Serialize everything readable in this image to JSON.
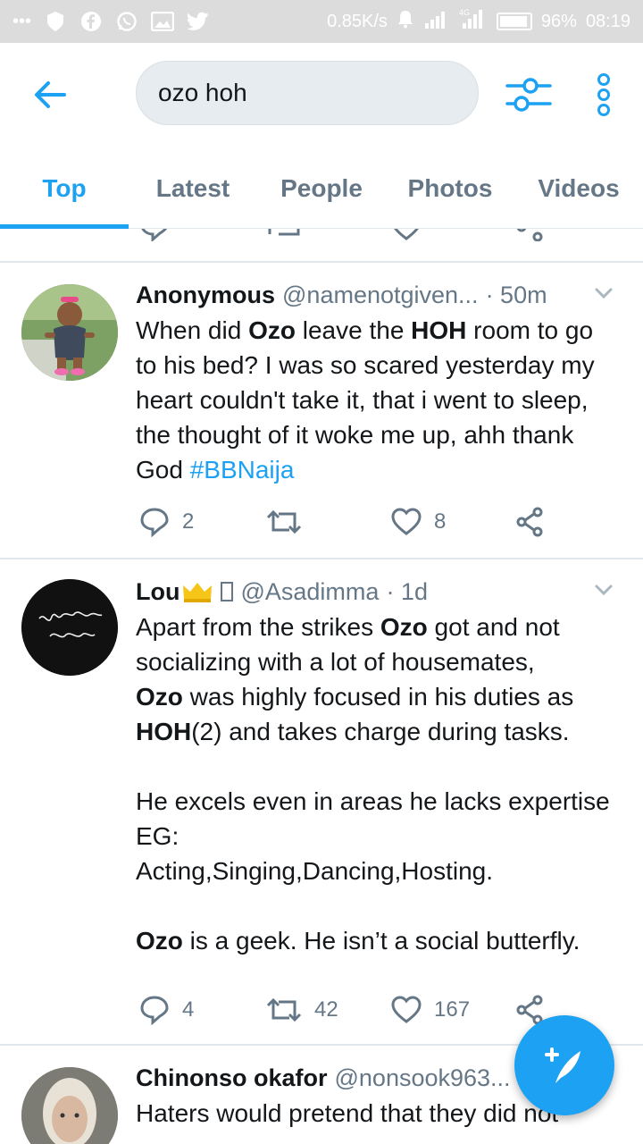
{
  "status_bar": {
    "net_speed": "0.85K/s",
    "battery": "96%",
    "time": "08:19"
  },
  "search": {
    "query": "ozo hoh"
  },
  "tabs": [
    {
      "label": "Top",
      "active": true
    },
    {
      "label": "Latest",
      "active": false
    },
    {
      "label": "People",
      "active": false
    },
    {
      "label": "Photos",
      "active": false
    },
    {
      "label": "Videos",
      "active": false
    }
  ],
  "tweets": [
    {
      "name": "Anonymous",
      "handle": "@namenotgiven...",
      "time": "· 50m",
      "replies": "2",
      "retweets": "",
      "likes": "8"
    },
    {
      "name": "Lou",
      "handle": "@Asadimma",
      "time": "· 1d",
      "replies": "4",
      "retweets": "42",
      "likes": "167",
      "avatar_text": "Wakanda Forever"
    },
    {
      "name": "Chinonso okafor",
      "handle": "@nonsook963...",
      "text": "Haters would pretend that they did not"
    }
  ],
  "tweet1_text": {
    "p1": "When did ",
    "b1": "Ozo",
    "p2": " leave the ",
    "b2": "HOH",
    "p3": " room to go to his bed? I was so scared yesterday my heart couldn't take it, that i went to sleep, the thought of it woke me up, ahh thank God ",
    "hashtag": "#BBNaija"
  },
  "tweet2_text": {
    "p1": "Apart from the strikes ",
    "b1": "Ozo",
    "p2": " got and not socializing with a lot of housemates,\n",
    "b2": "Ozo",
    "p3": " was highly focused in his duties as\n",
    "b3": "HOH",
    "p4": "(2) and takes charge during tasks.\n\nHe excels even in areas he lacks expertise EG:\nActing,Singing,Dancing,Hosting.\n\n",
    "b4": "Ozo",
    "p5": " is a geek. He isn’t a social butterfly."
  },
  "colors": {
    "accent": "#1da1f2",
    "secondary_text": "#657786",
    "divider": "#e1e8ed"
  },
  "icons": [
    "back-arrow-icon",
    "filter-icon",
    "more-vertical-icon",
    "reply-icon",
    "retweet-icon",
    "like-icon",
    "share-icon",
    "chevron-down-icon",
    "compose-icon"
  ]
}
